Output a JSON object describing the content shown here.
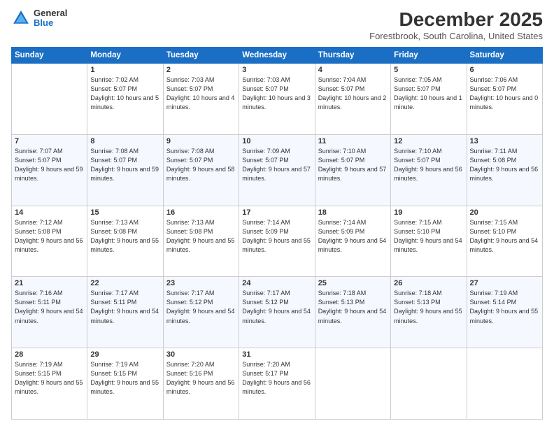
{
  "logo": {
    "general": "General",
    "blue": "Blue"
  },
  "header": {
    "month": "December 2025",
    "location": "Forestbrook, South Carolina, United States"
  },
  "weekdays": [
    "Sunday",
    "Monday",
    "Tuesday",
    "Wednesday",
    "Thursday",
    "Friday",
    "Saturday"
  ],
  "weeks": [
    [
      {
        "day": "",
        "empty": true
      },
      {
        "day": "1",
        "sunrise": "7:02 AM",
        "sunset": "5:07 PM",
        "daylight": "10 hours and 5 minutes."
      },
      {
        "day": "2",
        "sunrise": "7:03 AM",
        "sunset": "5:07 PM",
        "daylight": "10 hours and 4 minutes."
      },
      {
        "day": "3",
        "sunrise": "7:03 AM",
        "sunset": "5:07 PM",
        "daylight": "10 hours and 3 minutes."
      },
      {
        "day": "4",
        "sunrise": "7:04 AM",
        "sunset": "5:07 PM",
        "daylight": "10 hours and 2 minutes."
      },
      {
        "day": "5",
        "sunrise": "7:05 AM",
        "sunset": "5:07 PM",
        "daylight": "10 hours and 1 minute."
      },
      {
        "day": "6",
        "sunrise": "7:06 AM",
        "sunset": "5:07 PM",
        "daylight": "10 hours and 0 minutes."
      }
    ],
    [
      {
        "day": "7",
        "sunrise": "7:07 AM",
        "sunset": "5:07 PM",
        "daylight": "9 hours and 59 minutes."
      },
      {
        "day": "8",
        "sunrise": "7:08 AM",
        "sunset": "5:07 PM",
        "daylight": "9 hours and 59 minutes."
      },
      {
        "day": "9",
        "sunrise": "7:08 AM",
        "sunset": "5:07 PM",
        "daylight": "9 hours and 58 minutes."
      },
      {
        "day": "10",
        "sunrise": "7:09 AM",
        "sunset": "5:07 PM",
        "daylight": "9 hours and 57 minutes."
      },
      {
        "day": "11",
        "sunrise": "7:10 AM",
        "sunset": "5:07 PM",
        "daylight": "9 hours and 57 minutes."
      },
      {
        "day": "12",
        "sunrise": "7:10 AM",
        "sunset": "5:07 PM",
        "daylight": "9 hours and 56 minutes."
      },
      {
        "day": "13",
        "sunrise": "7:11 AM",
        "sunset": "5:08 PM",
        "daylight": "9 hours and 56 minutes."
      }
    ],
    [
      {
        "day": "14",
        "sunrise": "7:12 AM",
        "sunset": "5:08 PM",
        "daylight": "9 hours and 56 minutes."
      },
      {
        "day": "15",
        "sunrise": "7:13 AM",
        "sunset": "5:08 PM",
        "daylight": "9 hours and 55 minutes."
      },
      {
        "day": "16",
        "sunrise": "7:13 AM",
        "sunset": "5:08 PM",
        "daylight": "9 hours and 55 minutes."
      },
      {
        "day": "17",
        "sunrise": "7:14 AM",
        "sunset": "5:09 PM",
        "daylight": "9 hours and 55 minutes."
      },
      {
        "day": "18",
        "sunrise": "7:14 AM",
        "sunset": "5:09 PM",
        "daylight": "9 hours and 54 minutes."
      },
      {
        "day": "19",
        "sunrise": "7:15 AM",
        "sunset": "5:10 PM",
        "daylight": "9 hours and 54 minutes."
      },
      {
        "day": "20",
        "sunrise": "7:15 AM",
        "sunset": "5:10 PM",
        "daylight": "9 hours and 54 minutes."
      }
    ],
    [
      {
        "day": "21",
        "sunrise": "7:16 AM",
        "sunset": "5:11 PM",
        "daylight": "9 hours and 54 minutes."
      },
      {
        "day": "22",
        "sunrise": "7:17 AM",
        "sunset": "5:11 PM",
        "daylight": "9 hours and 54 minutes."
      },
      {
        "day": "23",
        "sunrise": "7:17 AM",
        "sunset": "5:12 PM",
        "daylight": "9 hours and 54 minutes."
      },
      {
        "day": "24",
        "sunrise": "7:17 AM",
        "sunset": "5:12 PM",
        "daylight": "9 hours and 54 minutes."
      },
      {
        "day": "25",
        "sunrise": "7:18 AM",
        "sunset": "5:13 PM",
        "daylight": "9 hours and 54 minutes."
      },
      {
        "day": "26",
        "sunrise": "7:18 AM",
        "sunset": "5:13 PM",
        "daylight": "9 hours and 55 minutes."
      },
      {
        "day": "27",
        "sunrise": "7:19 AM",
        "sunset": "5:14 PM",
        "daylight": "9 hours and 55 minutes."
      }
    ],
    [
      {
        "day": "28",
        "sunrise": "7:19 AM",
        "sunset": "5:15 PM",
        "daylight": "9 hours and 55 minutes."
      },
      {
        "day": "29",
        "sunrise": "7:19 AM",
        "sunset": "5:15 PM",
        "daylight": "9 hours and 55 minutes."
      },
      {
        "day": "30",
        "sunrise": "7:20 AM",
        "sunset": "5:16 PM",
        "daylight": "9 hours and 56 minutes."
      },
      {
        "day": "31",
        "sunrise": "7:20 AM",
        "sunset": "5:17 PM",
        "daylight": "9 hours and 56 minutes."
      },
      {
        "day": "",
        "empty": true
      },
      {
        "day": "",
        "empty": true
      },
      {
        "day": "",
        "empty": true
      }
    ]
  ]
}
